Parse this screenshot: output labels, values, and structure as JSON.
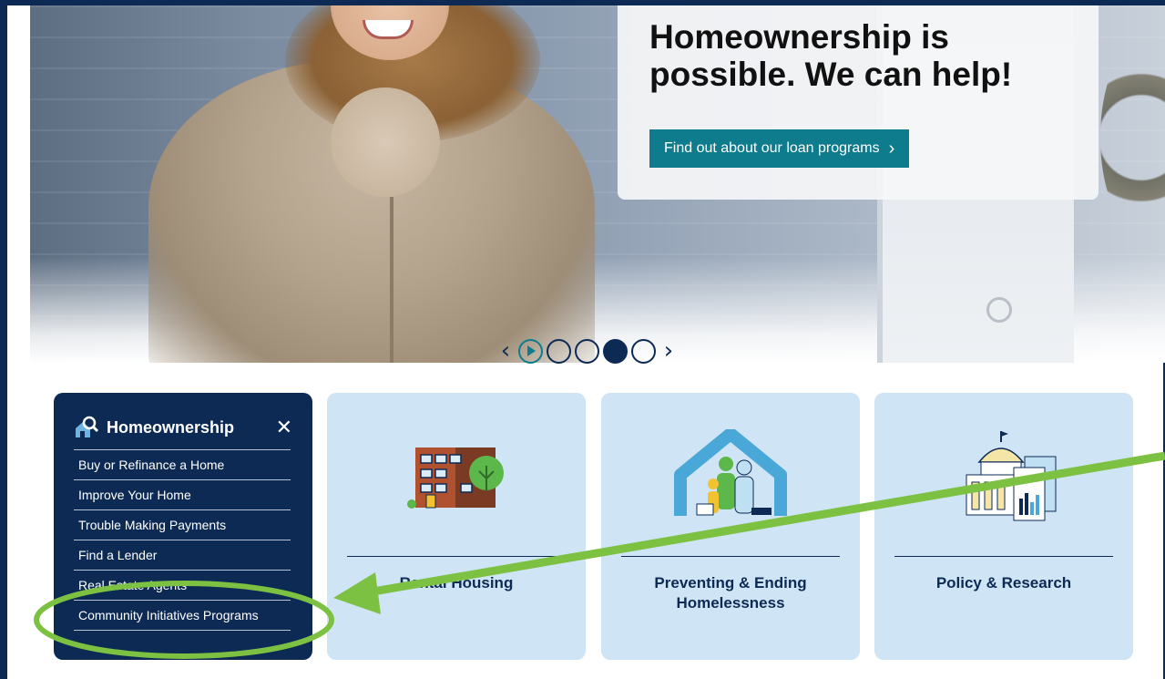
{
  "hero": {
    "headline": "Homeownership is possible. We can help!",
    "cta_label": "Find out about our loan programs",
    "cta_chevron": "›"
  },
  "carousel": {
    "prev": "‹",
    "next": "›",
    "slide_count": 4,
    "active_slide_index": 3,
    "mode": "play"
  },
  "menu": {
    "title": "Homeownership",
    "close": "✕",
    "items": [
      "Buy or Refinance a Home",
      "Improve Your Home",
      "Trouble Making Payments",
      "Find a Lender",
      "Real Estate Agents",
      "Community Initiatives Programs"
    ]
  },
  "cards": [
    {
      "label": "Rental Housing",
      "icon": "apartment-building-icon"
    },
    {
      "label": "Preventing & Ending Homelessness",
      "icon": "family-shelter-icon"
    },
    {
      "label": "Policy & Research",
      "icon": "capitol-report-icon"
    }
  ],
  "colors": {
    "navy": "#0d2a55",
    "teal": "#0e7c8c",
    "card_bg": "#cfe4f5",
    "annotation_green": "#7dc142"
  },
  "annotation": {
    "type": "arrow-and-ellipse",
    "target": "Community Initiatives Programs"
  }
}
